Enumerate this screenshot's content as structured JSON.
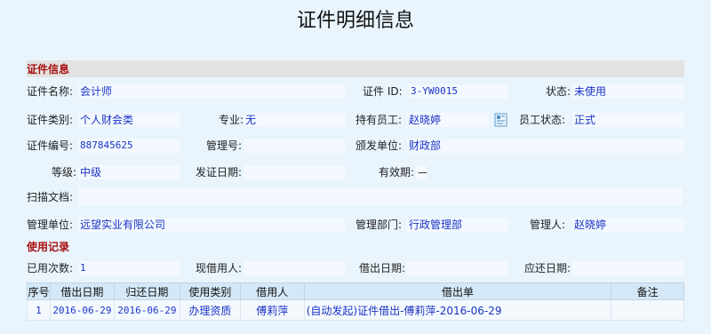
{
  "page": {
    "title": "证件明细信息"
  },
  "cert_section": {
    "heading": "证件信息",
    "name_label": "证件名称:",
    "name_value": "会计师",
    "id_label": "证件 ID:",
    "id_value": "3-YW0015",
    "status_label": "状态:",
    "status_value": "未使用",
    "category_label": "证件类别:",
    "category_value": "个人财会类",
    "major_label": "专业:",
    "major_value": "无",
    "holder_label": "持有员工:",
    "holder_value": "赵晓婷",
    "holder_icon": "lookup-icon",
    "emp_status_label": "员工状态:",
    "emp_status_value": "正式",
    "number_label": "证件编号:",
    "number_value": "887845625",
    "mgmt_no_label": "管理号:",
    "mgmt_no_value": "",
    "issuer_label": "颁发单位:",
    "issuer_value": "财政部",
    "grade_label": "等级:",
    "grade_value": "中级",
    "issue_date_label": "发证日期:",
    "issue_date_value": "",
    "validity_label": "有效期:",
    "validity_value": "—",
    "scan_label": "扫描文档:",
    "scan_value": "",
    "unit_label": "管理单位:",
    "unit_value": "远望实业有限公司",
    "dept_label": "管理部门:",
    "dept_value": "行政管理部",
    "manager_label": "管理人:",
    "manager_value": "赵晓婷"
  },
  "usage_section": {
    "heading": "使用记录",
    "used_count_label": "已用次数:",
    "used_count_value": "1",
    "borrower_label": "现借用人:",
    "borrower_value": "",
    "lend_date_label": "借出日期:",
    "lend_date_value": "",
    "return_due_label": "应还日期:",
    "return_due_value": ""
  },
  "records": {
    "columns": [
      "序号",
      "借出日期",
      "归还日期",
      "使用类别",
      "借用人",
      "借出单",
      "备注"
    ],
    "rows": [
      {
        "no": "1",
        "lend": "2016-06-29",
        "return": "2016-06-29",
        "type": "办理资质",
        "person": "傅莉萍",
        "form": "(自动发起)证件借出-傅莉萍-2016-06-29",
        "note": ""
      }
    ]
  }
}
